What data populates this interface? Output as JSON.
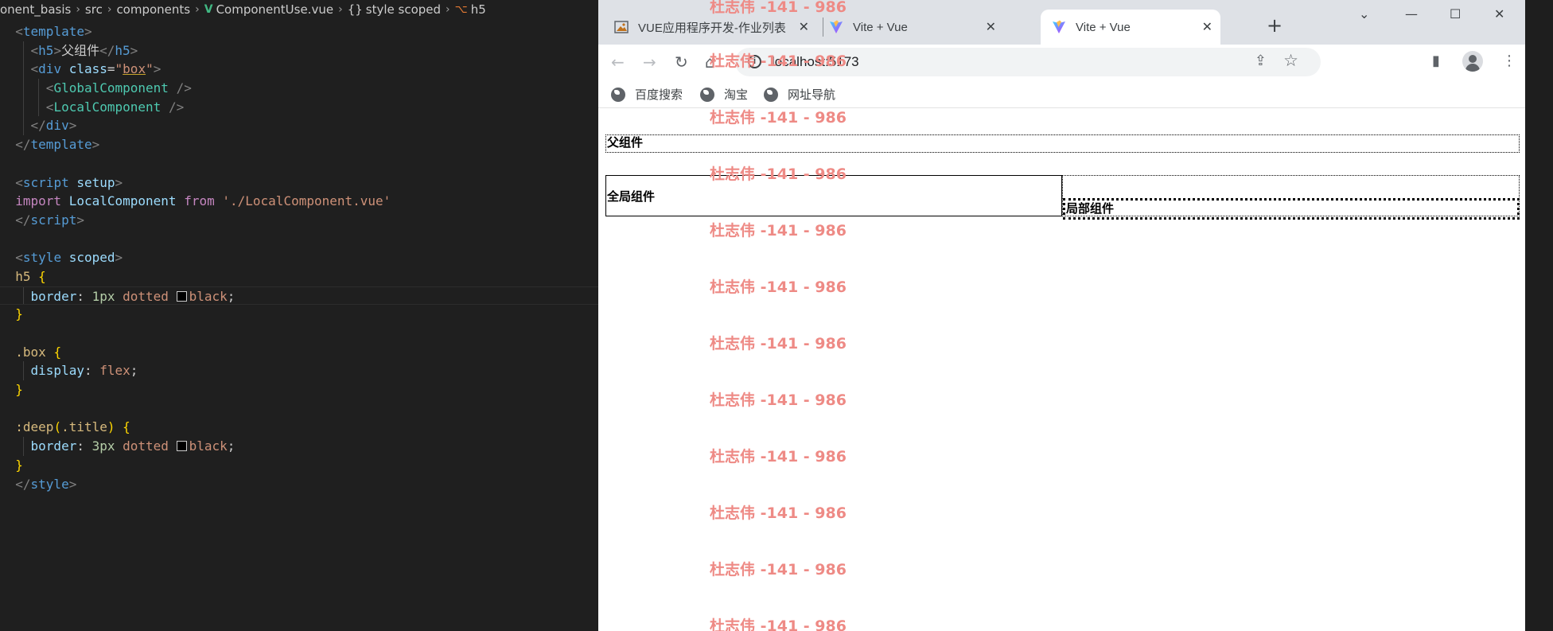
{
  "editor": {
    "breadcrumb": [
      "onent_basis",
      "src",
      "components",
      "ComponentUse.vue",
      "style scoped",
      "h5"
    ]
  },
  "code": {
    "template_open": "template",
    "h5_open": "h5",
    "h5_text": "父组件",
    "div_tag": "div",
    "class_attr": "class",
    "box_value": "box",
    "global_component": "GlobalComponent",
    "local_component": "LocalComponent",
    "self_close": "/>",
    "script_tag": "script",
    "setup_attr": "setup",
    "import_kw": "import",
    "import_name": "LocalComponent",
    "from_kw": "from",
    "import_path": "'./LocalComponent.vue'",
    "style_tag": "style",
    "scoped_attr": "scoped",
    "sel_h5": "h5",
    "prop_border": "border",
    "val_1px": "1px",
    "val_3px": "3px",
    "val_dotted": "dotted",
    "val_black": "black",
    "sel_box": ".box",
    "prop_display": "display",
    "val_flex": "flex",
    "sel_deep": ":deep",
    "sel_title": ".title"
  },
  "browser": {
    "tabs": [
      {
        "title": "VUE应用程序开发-作业列表"
      },
      {
        "title": "Vite + Vue"
      },
      {
        "title": "Vite + Vue"
      }
    ],
    "url": "localhost:5173",
    "bookmarks": [
      "百度搜索",
      "淘宝",
      "网址导航"
    ]
  },
  "page": {
    "h5_text": "父组件",
    "global_text": "全局组件",
    "local_text": "局部组件"
  },
  "watermark": "杜志伟 -141 - 986",
  "colors": {
    "editor_bg": "#1f1f1f",
    "tag": "#569cd6",
    "component": "#4ec9b0",
    "string": "#ce9178",
    "keyword": "#c586c0",
    "selector": "#d7ba7d",
    "property": "#9cdcfe",
    "number": "#b5cea8",
    "watermark": "#ee8a85",
    "tabstrip": "#dee1e6"
  }
}
